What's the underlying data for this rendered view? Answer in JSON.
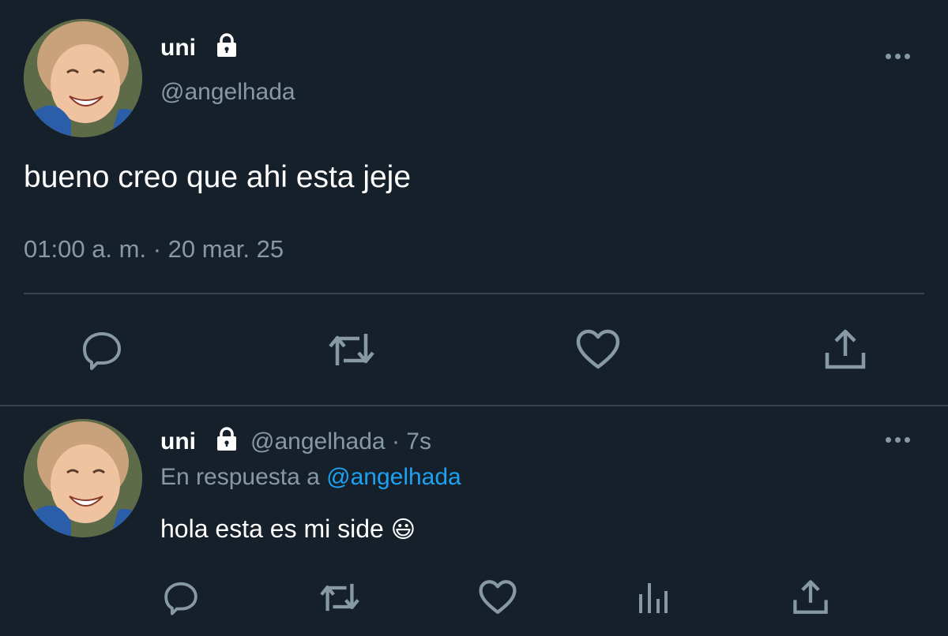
{
  "main_tweet": {
    "display_name": "uni",
    "handle": "@angelhada",
    "text": "bueno creo que ahi esta jeje",
    "timestamp": "01:00 a. m. · 20 mar. 25",
    "icons": [
      "lock-icon",
      "more-icon",
      "reply-icon",
      "retweet-icon",
      "like-icon",
      "share-icon"
    ]
  },
  "reply_tweet": {
    "display_name": "uni",
    "handle": "@angelhada",
    "separator": "·",
    "time_ago": "7s",
    "reply_prefix": "En respuesta a",
    "reply_to": "@angelhada",
    "text": "hola esta es mi side",
    "emoji": "😃",
    "icons": [
      "lock-icon",
      "more-icon",
      "reply-icon",
      "retweet-icon",
      "like-icon",
      "analytics-icon",
      "share-icon"
    ]
  },
  "colors": {
    "background": "#15202b",
    "text": "#ffffff",
    "muted": "#8899a6",
    "link": "#1da1f2",
    "divider": "#38444d"
  }
}
